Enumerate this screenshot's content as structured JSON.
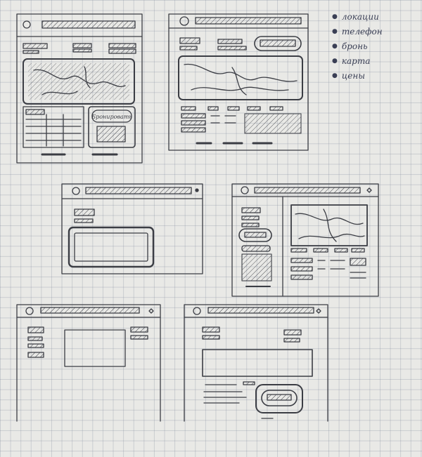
{
  "legend": {
    "items": [
      {
        "label": "локации"
      },
      {
        "label": "телефон"
      },
      {
        "label": "бронь"
      },
      {
        "label": "карта"
      },
      {
        "label": "цены"
      }
    ]
  },
  "wireframes": {
    "booking_button_label": "Бронировать"
  },
  "colors": {
    "paper": "#e9e9e6",
    "grid": "#9aa2b4",
    "pencil": "#3b3d44"
  }
}
